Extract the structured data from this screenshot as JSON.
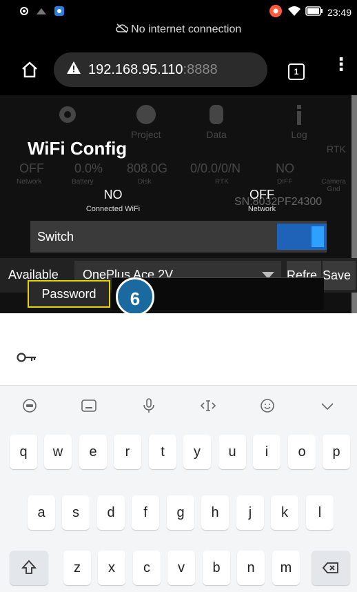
{
  "status_bar": {
    "time": "23:49"
  },
  "banner": {
    "no_internet": "No internet connection"
  },
  "browser": {
    "url_host": "192.168.95.110",
    "url_port": ":8888",
    "tab_count": "1"
  },
  "bg": {
    "icons": [
      "Project",
      "Data",
      "Log",
      "RTK"
    ],
    "values": [
      "OFF",
      "0.0%",
      "808.0G",
      "0/0.0/0/N",
      "NO"
    ],
    "labels": [
      "Network",
      "Battery",
      "Disk",
      "RTK",
      "DIFF",
      "Camera Gnd"
    ],
    "sn": "SN:8032PF24300"
  },
  "dialog": {
    "title": "WiFi Config",
    "wifi_value": "NO",
    "wifi_label": "Connected WiFi",
    "net_value": "OFF",
    "net_label": "Network",
    "switch_label": "Switch",
    "available_label": "Available",
    "available_value": "OnePlus Ace 2V",
    "refresh_label": "Refre",
    "save_label": "Save",
    "password_label": "Password"
  },
  "annotation": {
    "step": "6"
  },
  "keyboard": {
    "row1": [
      "q",
      "w",
      "e",
      "r",
      "t",
      "y",
      "u",
      "i",
      "o",
      "p"
    ],
    "row2": [
      "a",
      "s",
      "d",
      "f",
      "g",
      "h",
      "j",
      "k",
      "l"
    ],
    "row3": [
      "z",
      "x",
      "c",
      "v",
      "b",
      "n",
      "m"
    ]
  },
  "colors": {
    "toggle_on": "#2ea0ff",
    "highlight": "#e8d400",
    "badge": "#1a6aa0"
  }
}
